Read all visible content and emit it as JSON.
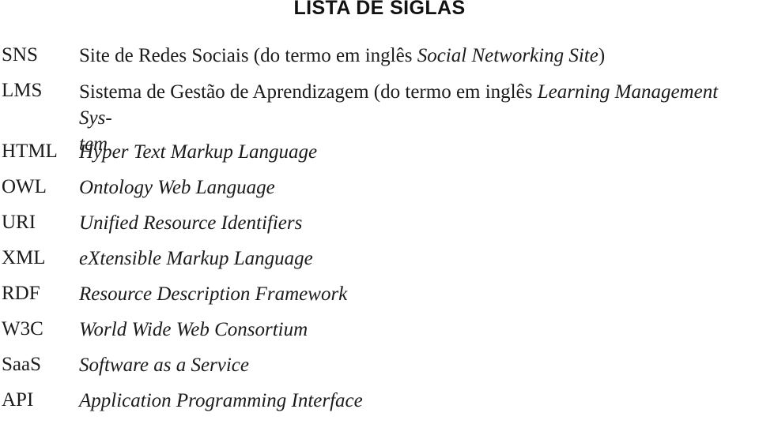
{
  "page": {
    "title": "LISTA DE SIGLAS",
    "background_color": "#ffffff",
    "text_color": "#1b1b1b"
  },
  "siglas": [
    {
      "term": "SNS",
      "definition_full": "Site de Redes Sociais (do termo em inglês Social Networking Site)",
      "definition_lead": "Site de Redes Sociais (do termo em inglês ",
      "definition_english": "Social Networking Site",
      "definition_tail": ")"
    },
    {
      "term": "LMS",
      "definition_full": "Sistema de Gestão de Aprendizagem (do termo em inglês Learning Management System",
      "definition_lead": "Sistema de Gestão de Aprendizagem (do termo em inglês ",
      "definition_english": "Learning Management Sys-",
      "definition_continuation": "tem",
      "definition_tail": ""
    },
    {
      "term": "HTML",
      "definition_full": "Hyper Text Markup Language"
    },
    {
      "term": "OWL",
      "definition_full": "Ontology Web Language"
    },
    {
      "term": "URI",
      "definition_full": "Unified Resource Identifiers"
    },
    {
      "term": "XML",
      "definition_full": "eXtensible Markup Language"
    },
    {
      "term": "RDF",
      "definition_full": "Resource Description Framework"
    },
    {
      "term": "W3C",
      "definition_full": "World Wide Web Consortium"
    },
    {
      "term": "SaaS",
      "definition_full": "Software as a Service"
    },
    {
      "term": "API",
      "definition_full": "Application Programming Interface"
    }
  ]
}
